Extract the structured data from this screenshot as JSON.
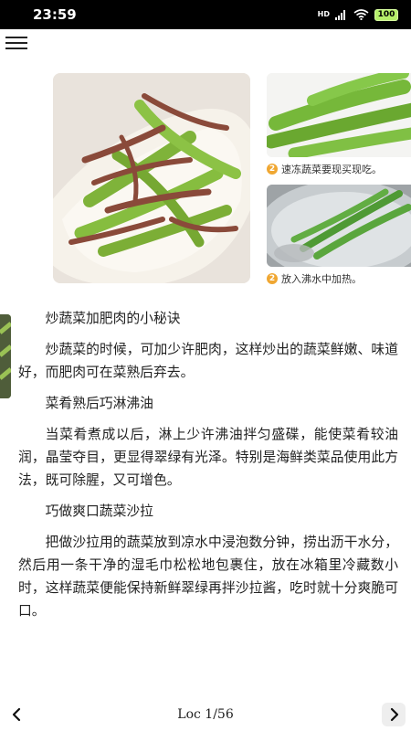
{
  "status_bar": {
    "time": "23:59",
    "network_label": "HD",
    "battery": "100",
    "icons": [
      "signal-icon",
      "wifi-icon",
      "battery-icon"
    ]
  },
  "toolbar": {
    "menu_icon": "hamburger-menu-icon"
  },
  "illustrations": {
    "captions": [
      {
        "number": "2",
        "text": "速冻蔬菜要现买现吃。"
      },
      {
        "number": "2",
        "text": "放入沸水中加热。"
      }
    ]
  },
  "article": {
    "paragraphs": [
      "炒蔬菜加肥肉的小秘诀",
      "炒蔬菜的时候，可加少许肥肉，这样炒出的蔬菜鲜嫩、味道好，而肥肉可在菜熟后弃去。",
      "菜肴熟后巧淋沸油",
      "当菜肴煮成以后，淋上少许沸油拌匀盛碟，能使菜肴较油润，晶莹夺目，更显得翠绿有光泽。特别是海鲜类菜品使用此方法，既可除腥，又可增色。",
      "巧做爽口蔬菜沙拉",
      "把做沙拉用的蔬菜放到凉水中浸泡数分钟，捞出沥干水分，然后用一条干净的湿毛巾松松地包裹住，放在冰箱里冷藏数小时，这样蔬菜便能保持新鲜翠绿再拌沙拉酱，吃时就十分爽脆可口。"
    ]
  },
  "footer": {
    "location": "Loc 1/56",
    "prev_icon": "chevron-left-icon",
    "next_icon": "chevron-right-icon"
  }
}
